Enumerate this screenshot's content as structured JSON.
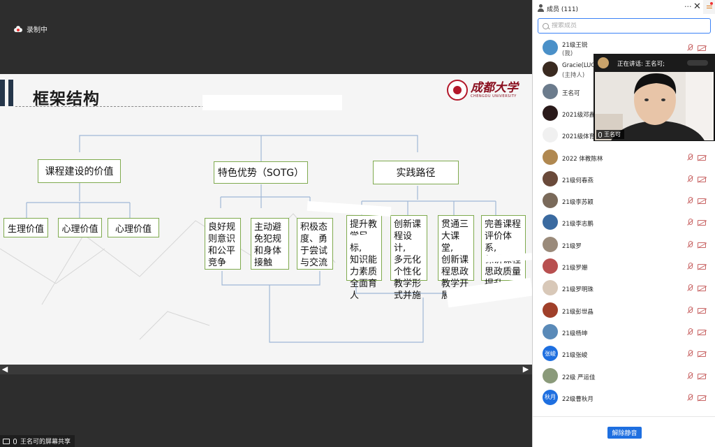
{
  "recording": {
    "label": "录制中"
  },
  "slide": {
    "title": "框架结构",
    "logo_text": "成都大学",
    "logo_subtext": "CHENGDU UNIVERSITY",
    "categories": [
      "课程建设的价值",
      "特色优势（SOTG）",
      "实践路径"
    ],
    "value_items": [
      "生理价值",
      "心理价值",
      "心理价值"
    ],
    "feature_items": [
      "良好规\n则意识\n和公平\n竞争",
      "主动避\n免犯规\n和身体\n接触",
      "积极态\n度、勇\n于尝试\n与交流"
    ],
    "path_items": [
      "提升教\n学目标,\n知识能\n力素质\n全面育\n人",
      "创新课\n程设计,\n多元化\n个性化\n教学形\n式并施",
      "贯通三\n大课堂,\n创新课\n程思政\n教学开\n展形式",
      "完善课程\n评价体系,\n保讲课程\n思政质量\n提升"
    ]
  },
  "nav": {
    "prev": "◀",
    "next": "▶"
  },
  "share_badge": {
    "label": "王名可的屏幕共享"
  },
  "panel": {
    "title": "成员 (111)",
    "more": "···",
    "close": "✕",
    "search_placeholder": "搜索成员",
    "unmute_all": "解除静音"
  },
  "members": [
    {
      "name": "21级王锐",
      "role": "(我)",
      "avatar_color": "#4a90c8",
      "avatar_text": ""
    },
    {
      "name": "Gracie(LUO",
      "role": "(主持人)",
      "avatar_color": "#3a2a20",
      "avatar_text": ""
    },
    {
      "name": "王名可",
      "role": "",
      "avatar_color": "#6b7b8c",
      "avatar_text": ""
    },
    {
      "name": "2021级邓鑫",
      "role": "",
      "avatar_color": "#2a1a1a",
      "avatar_text": ""
    },
    {
      "name": "2021级体育",
      "role": "",
      "avatar_color": "#f0f0f0",
      "avatar_text": ""
    },
    {
      "name": "2022 体教陈林",
      "role": "",
      "avatar_color": "#b08850",
      "avatar_text": ""
    },
    {
      "name": "21级何春燕",
      "role": "",
      "avatar_color": "#6a4a3a",
      "avatar_text": ""
    },
    {
      "name": "21级李苏颖",
      "role": "",
      "avatar_color": "#7a6a5a",
      "avatar_text": ""
    },
    {
      "name": "21级李志鹏",
      "role": "",
      "avatar_color": "#3a6aa0",
      "avatar_text": ""
    },
    {
      "name": "21级罗",
      "role": "",
      "avatar_color": "#9a8a7a",
      "avatar_text": ""
    },
    {
      "name": "21级罗姗",
      "role": "",
      "avatar_color": "#b85050",
      "avatar_text": ""
    },
    {
      "name": "21级罗明珠",
      "role": "",
      "avatar_color": "#d8c8b8",
      "avatar_text": ""
    },
    {
      "name": "21级彭世晶",
      "role": "",
      "avatar_color": "#a0402a",
      "avatar_text": ""
    },
    {
      "name": "21级杨坤",
      "role": "",
      "avatar_color": "#5a8ab8",
      "avatar_text": ""
    },
    {
      "name": "21级张峻",
      "role": "",
      "avatar_color": "#1e6fe0",
      "avatar_text": "张峻"
    },
    {
      "name": "22级 严运佳",
      "role": "",
      "avatar_color": "#8a9a7a",
      "avatar_text": ""
    },
    {
      "name": "22级曹秋月",
      "role": "",
      "avatar_color": "#1e6fe0",
      "avatar_text": "秋月"
    }
  ],
  "video": {
    "speaking_label": "正在讲话: 王名可;",
    "name_tag": "王名可"
  }
}
